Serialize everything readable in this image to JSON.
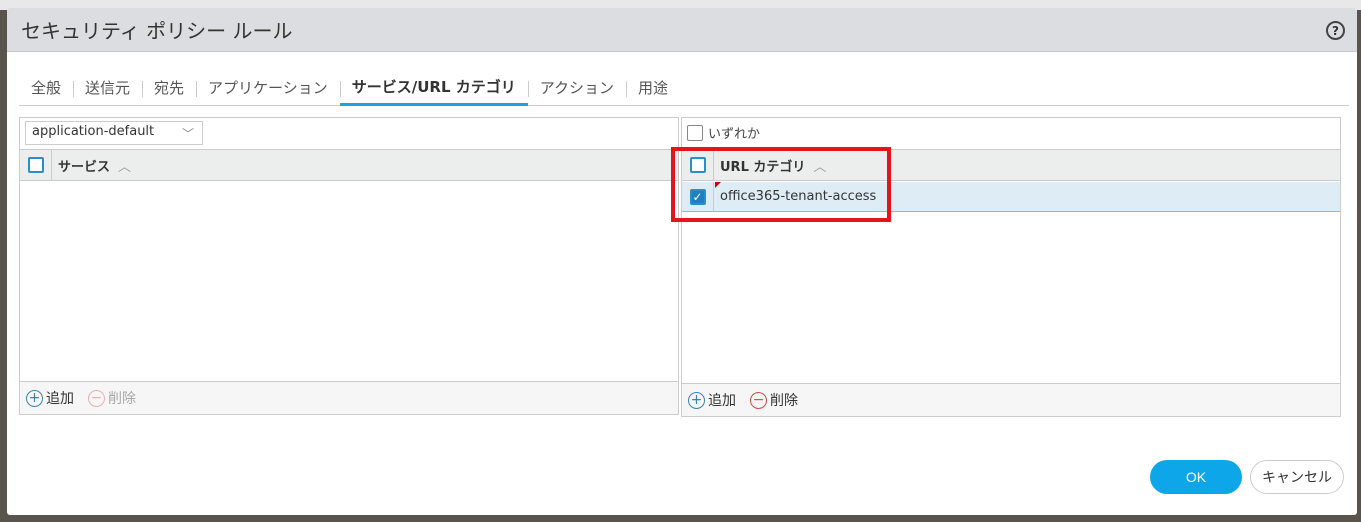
{
  "dialog": {
    "title": "セキュリティ ポリシー ルール",
    "help": "?"
  },
  "tabs": [
    "全般",
    "送信元",
    "宛先",
    "アプリケーション",
    "サービス/URL カテゴリ",
    "アクション",
    "用途"
  ],
  "active_tab": 4,
  "service": {
    "select_value": "application-default",
    "column": "サービス",
    "add": "追加",
    "delete": "削除"
  },
  "url": {
    "any_label": "いずれか",
    "column": "URL カテゴリ",
    "rows": [
      {
        "name": "office365-tenant-access",
        "checked": true
      }
    ],
    "add": "追加",
    "delete": "削除"
  },
  "buttons": {
    "ok": "OK",
    "cancel": "キャンセル"
  }
}
